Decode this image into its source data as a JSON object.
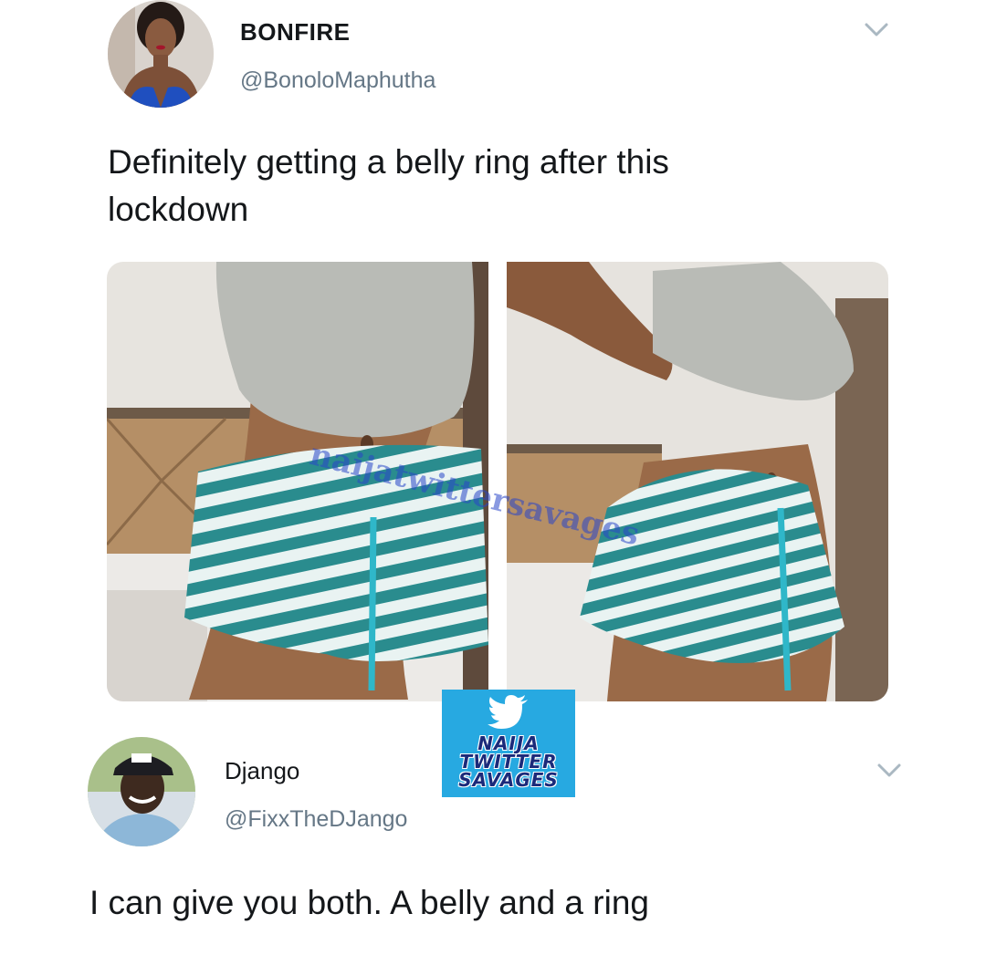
{
  "tweets": [
    {
      "display_name": "BONFIRE",
      "handle": "@BonoloMaphutha",
      "text": "Definitely getting a belly ring after this lockdown",
      "menu_icon": "chevron-down-icon",
      "media_count": 2
    },
    {
      "display_name": "Django",
      "handle": "@FixxTheDJango",
      "text": "I can give you both. A belly and a ring",
      "menu_icon": "chevron-down-icon"
    }
  ],
  "watermark": {
    "text": "naijatwittersavages",
    "logo_lines": [
      "NAIJA",
      "TWITTER",
      "SAVAGES"
    ],
    "logo_icon": "bird-icon"
  },
  "colors": {
    "handle_gray": "#657786",
    "chevron": "#aab8c2",
    "logo_blue": "#27a9e1",
    "logo_text": "#1b2a7a",
    "stripe_teal": "#2a8c8e",
    "shirt_gray": "#b9bbb6"
  }
}
